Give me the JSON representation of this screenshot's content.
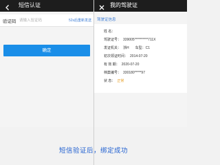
{
  "left": {
    "title": "短信认证",
    "sms_label": "验证码",
    "sms_placeholder": "请输入验证码",
    "resend_text": "52s后重新发送",
    "confirm_label": "确定"
  },
  "right": {
    "title": "我的驾驶证",
    "section_title": "驾驶证信息",
    "fields": [
      {
        "key": "姓      名：",
        "value": ""
      },
      {
        "key": "驾驶证号：",
        "value": "339005**********711X"
      },
      {
        "key": "发证机关：",
        "value": "浙H",
        "extra": "车型：C1"
      },
      {
        "key": "初次领证时间：",
        "value": "2014-07-20"
      },
      {
        "key": "有 效 期：",
        "value": "2020-07-20"
      },
      {
        "key": "档案编号：",
        "value": "330180*****97"
      },
      {
        "key": "状      态：",
        "value": "正常"
      }
    ]
  },
  "caption": "短信验证后，绑定成功",
  "colors": {
    "accent": "#1a8ee8",
    "link": "#3a7bd5",
    "status_ok": "#e59a1c",
    "caption": "#1f5fd0"
  }
}
